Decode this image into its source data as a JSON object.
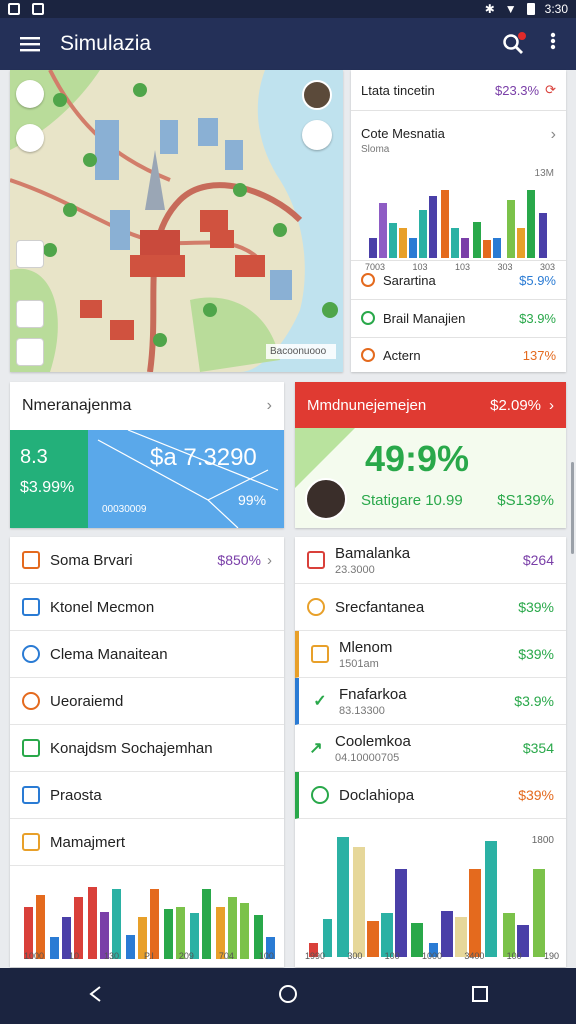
{
  "status": {
    "time": "3:30"
  },
  "app": {
    "title": "Simulazia"
  },
  "top_panel": {
    "header_label": "Ltata tincetin",
    "header_value": "$23.3%",
    "chart_title": "Cote Mesnatia",
    "chart_subtitle": "Sloma",
    "chart_corner": "13M",
    "chart_ticks": [
      "7003",
      "103",
      "103",
      "303",
      "303"
    ],
    "rows": [
      {
        "label": "Sarartina",
        "value": "$5.9%",
        "color": "#2a7bd4"
      },
      {
        "label": "Brail Manajien",
        "value": "$3.9%",
        "color": "#29a84a"
      },
      {
        "label": "Actern",
        "value": "137%",
        "color": "#e46a1e"
      }
    ]
  },
  "map": {
    "legend": "Bacoonuooo"
  },
  "banner_left": {
    "title": "Nmeranajenma",
    "small_value": "8.3",
    "main_value": "$3.99%",
    "big_value": "$a 7.3290",
    "pct": "99%",
    "code": "00030009"
  },
  "banner_right": {
    "title": "Mmdnunejemejen",
    "title_value": "$2.09%",
    "big_value": "49:9%",
    "label": "Statigare 10.99",
    "value": "$S139%"
  },
  "list_left": [
    {
      "label": "Soma Brvari",
      "value": "$850%",
      "color": "#e46a1e"
    },
    {
      "label": "Ktonel Mecmon",
      "value": "",
      "color": "#2a7bd4"
    },
    {
      "label": "Clema Manaitean",
      "value": "",
      "color": "#2a7bd4"
    },
    {
      "label": "Ueoraiemd",
      "value": "",
      "color": "#e46a1e"
    },
    {
      "label": "Konajdsm Sochajemhan",
      "value": "",
      "color": "#29a84a"
    },
    {
      "label": "Praosta",
      "value": "",
      "color": "#2a7bd4"
    },
    {
      "label": "Mamajmert",
      "value": "",
      "color": "#e8a02a"
    }
  ],
  "list_left_chart_ticks": [
    "1000",
    "10",
    "130",
    "P.I",
    "209",
    "704",
    "100"
  ],
  "list_right": [
    {
      "label": "Bamalanka",
      "sub": "23.3000",
      "value": "$264",
      "color": "#d9403a",
      "value_color": "#7a3fa8"
    },
    {
      "label": "Srecfantanea",
      "sub": "",
      "value": "$39%",
      "color": "#e8a02a",
      "value_color": "#29a84a"
    },
    {
      "label": "Mlenom",
      "sub": "1501am",
      "value": "$39%",
      "color": "#e8a02a",
      "value_color": "#29a84a"
    },
    {
      "label": "Fnafarkoa",
      "sub": "83.13300",
      "value": "$3.9%",
      "color": "#29a84a",
      "value_color": "#29a84a"
    },
    {
      "label": "Coolemkoa",
      "sub": "04.10000705",
      "value": "$354",
      "color": "#29a84a",
      "value_color": "#29a84a"
    },
    {
      "label": "Doclahiopa",
      "sub": "",
      "value": "$39%",
      "color": "#29a84a",
      "value_color": "#e46a1e"
    }
  ],
  "list_right_chart_ticks": [
    "1990",
    "300",
    "100",
    "1000",
    "3400",
    "100",
    "190",
    "1800"
  ],
  "list_right_chart_corner": "1800"
}
